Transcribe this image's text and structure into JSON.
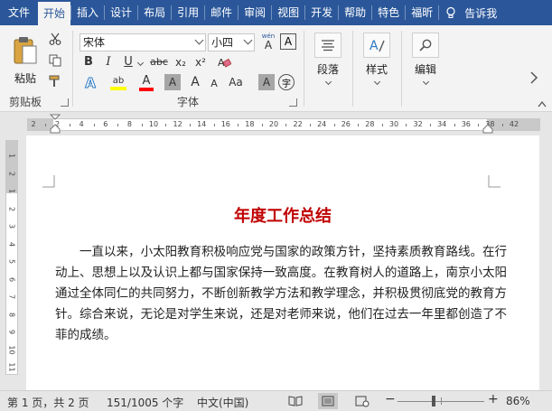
{
  "menubar": {
    "tabs": [
      {
        "label": "文件"
      },
      {
        "label": "开始"
      },
      {
        "label": "插入"
      },
      {
        "label": "设计"
      },
      {
        "label": "布局"
      },
      {
        "label": "引用"
      },
      {
        "label": "邮件"
      },
      {
        "label": "审阅"
      },
      {
        "label": "视图"
      },
      {
        "label": "开发"
      },
      {
        "label": "帮助"
      },
      {
        "label": "特色"
      },
      {
        "label": "福昕"
      }
    ],
    "tell_me": "告诉我"
  },
  "ribbon": {
    "clipboard": {
      "paste_label": "粘贴",
      "group_label": "剪贴板"
    },
    "font": {
      "font_name": "宋体",
      "font_size": "小四",
      "phonetic_glyph": "wén",
      "phonetic_char": "A",
      "bold": "B",
      "italic": "I",
      "underline": "U",
      "strikethrough": "abc",
      "subscript": "x₂",
      "superscript": "x²",
      "text_effects": "A",
      "highlight": "ab",
      "font_color": "A",
      "char_shading": "A",
      "grow": "A",
      "shrink": "A",
      "change_case": "Aa",
      "clear_format": "A",
      "enclose_char": "字",
      "group_label": "字体"
    },
    "paragraph": {
      "label": "段落"
    },
    "styles": {
      "label": "样式"
    },
    "editing": {
      "label": "编辑"
    }
  },
  "ruler": {
    "numbers": [
      "2",
      "2",
      "4",
      "6",
      "8",
      "10",
      "12",
      "14",
      "16",
      "18",
      "20",
      "22",
      "24",
      "26",
      "28",
      "30",
      "32",
      "34",
      "36",
      "38",
      "42"
    ]
  },
  "vruler": {
    "numbers": [
      "1",
      "2",
      "1",
      "2",
      "3",
      "4",
      "5",
      "6",
      "7",
      "8",
      "9",
      "10",
      "11"
    ]
  },
  "document": {
    "title": "年度工作总结",
    "body": "一直以来，小太阳教育积极响应党与国家的政策方针，坚持素质教育路线。在行动上、思想上以及认识上都与国家保持一致高度。在教育树人的道路上，南京小太阳通过全体同仁的共同努力，不断创新教学方法和教学理念，并积极贯彻底党的教育方针。综合来说，无论是对学生来说，还是对老师来说，他们在过去一年里都创造了不菲的成绩。"
  },
  "statusbar": {
    "page_info": "第 1 页，共 2 页",
    "word_count": "151/1005 个字",
    "language": "中文(中国)",
    "zoom_minus": "−",
    "zoom_plus": "+",
    "zoom_level": "86%"
  },
  "colors": {
    "brand": "#2b579a",
    "title_red": "#c00000",
    "highlight_yellow": "#ffff00",
    "font_color_red": "#ff0000"
  }
}
